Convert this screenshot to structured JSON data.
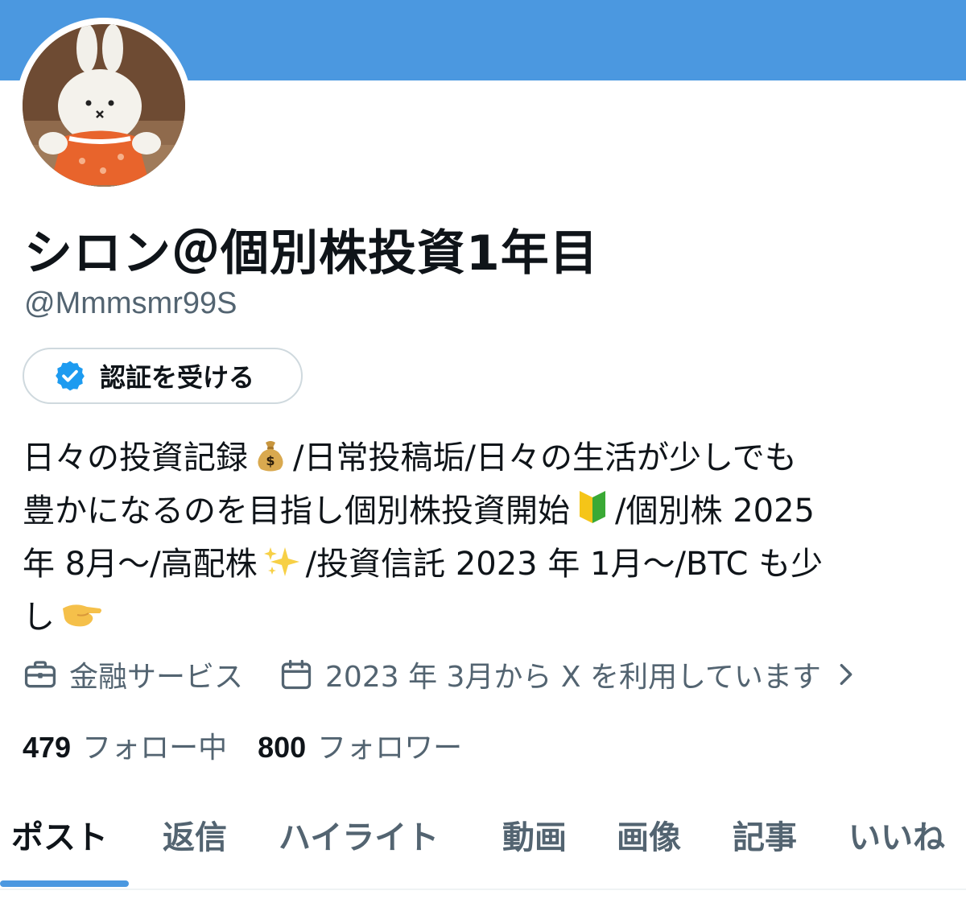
{
  "profile": {
    "display_name": "シロン＠個別株投資1年目",
    "handle": "@Mmmsmr99S",
    "verify_label": "認証を受ける"
  },
  "bio": {
    "line1_a": "日々の投資記録",
    "line1_b": "/日常投稿垢/日々の生活が少しでも",
    "line2_a": "豊かになるのを目指し個別株投資開始",
    "line2_b": "/個別株 2025",
    "line3_a": "年 8月〜/高配株",
    "line3_b": "/投資信託 2023 年 1月〜/BTC も少",
    "line4_a": "し",
    "emojis": [
      "money-bag",
      "beginner-mark",
      "sparkles",
      "pinching-hand"
    ]
  },
  "meta": {
    "category": "金融サービス",
    "joined": "2023 年 3月から X を利用しています"
  },
  "stats": {
    "following_count": "479",
    "following_label": "フォロー中",
    "followers_count": "800",
    "followers_label": "フォロワー"
  },
  "tabs": [
    {
      "label": "ポスト",
      "active": true
    },
    {
      "label": "返信",
      "active": false
    },
    {
      "label": "ハイライト",
      "active": false
    },
    {
      "label": "動画",
      "active": false
    },
    {
      "label": "画像",
      "active": false
    },
    {
      "label": "記事",
      "active": false
    },
    {
      "label": "いいね",
      "active": false
    }
  ],
  "colors": {
    "banner": "#4b98e0",
    "accent": "#1d9bf0",
    "text_primary": "#0f1419",
    "text_secondary": "#536471"
  }
}
